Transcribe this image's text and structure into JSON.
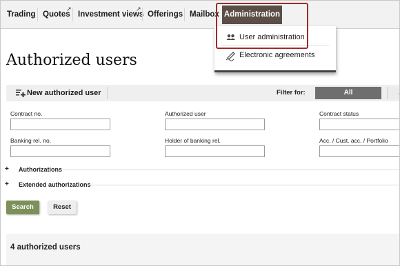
{
  "nav": {
    "items": [
      {
        "label": "Trading",
        "external": false
      },
      {
        "label": "Quotes",
        "external": true
      },
      {
        "label": "Investment views",
        "external": true
      },
      {
        "label": "Offerings",
        "external": false
      },
      {
        "label": "Mailbox",
        "external": false
      }
    ],
    "active": "Administration",
    "external_marker": "↗"
  },
  "dropdown": {
    "items": [
      {
        "label": "User administration",
        "icon": "users-icon"
      },
      {
        "label": "Electronic agreements",
        "icon": "signature-pen-icon"
      }
    ]
  },
  "page": {
    "title": "Authorized users"
  },
  "toolbar": {
    "new_label": "New authorized user",
    "filter_label": "Filter for:",
    "filter_all": "All",
    "filter_next": "A"
  },
  "form": {
    "contract_no": {
      "label": "Contract no.",
      "value": ""
    },
    "authorized_user": {
      "label": "Authorized user",
      "value": ""
    },
    "contract_status": {
      "label": "Contract status",
      "value": ""
    },
    "banking_rel_no": {
      "label": "Banking rel. no.",
      "value": ""
    },
    "holder_banking_rel": {
      "label": "Holder of banking rel.",
      "value": ""
    },
    "acc_portfolio": {
      "label": "Acc. / Cust. acc. / Portfolio",
      "value": ""
    }
  },
  "sections": {
    "plus": "+",
    "authorizations": "Authorizations",
    "extended": "Extended authorizations"
  },
  "buttons": {
    "search": "Search",
    "reset": "Reset"
  },
  "results": {
    "count_label": "4 authorized users"
  },
  "colors": {
    "accent_admin": "#5a4e46",
    "search_button": "#7c9059",
    "filter_active": "#6e6e6e",
    "highlight_border": "#9b2b2b"
  }
}
